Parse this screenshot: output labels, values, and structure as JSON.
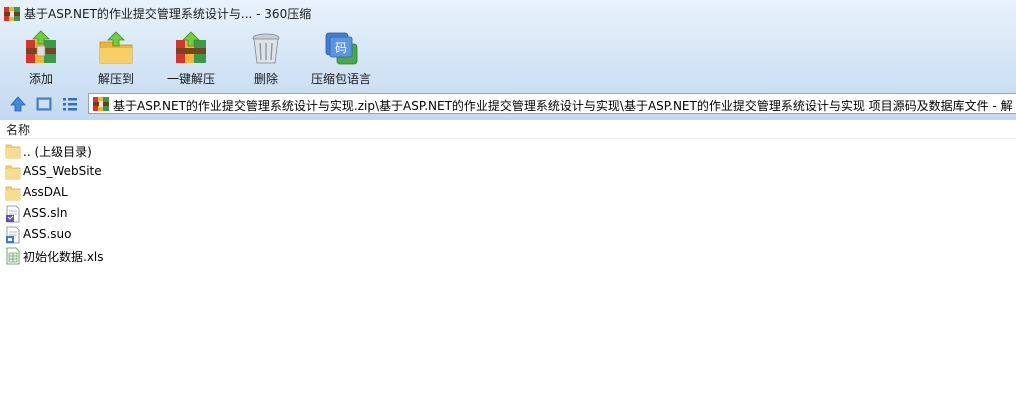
{
  "window": {
    "title": "基于ASP.NET的作业提交管理系统设计与... - 360压缩"
  },
  "toolbar": {
    "buttons": [
      {
        "label": "添加",
        "icon": "add-archive-icon"
      },
      {
        "label": "解压到",
        "icon": "extract-to-icon"
      },
      {
        "label": "一键解压",
        "icon": "one-click-extract-icon"
      },
      {
        "label": "删除",
        "icon": "delete-icon"
      },
      {
        "label": "压缩包语言",
        "icon": "archive-language-icon"
      }
    ]
  },
  "address_bar": {
    "path": "基于ASP.NET的作业提交管理系统设计与实现.zip\\基于ASP.NET的作业提交管理系统设计与实现\\基于ASP.NET的作业提交管理系统设计与实现 项目源码及数据库文件 - 解"
  },
  "file_list": {
    "column_name": "名称",
    "items": [
      {
        "name": ".. (上级目录)",
        "type": "folder"
      },
      {
        "name": "ASS_WebSite",
        "type": "folder"
      },
      {
        "name": "AssDAL",
        "type": "folder"
      },
      {
        "name": "ASS.sln",
        "type": "sln"
      },
      {
        "name": "ASS.suo",
        "type": "suo"
      },
      {
        "name": "初始化数据.xls",
        "type": "xls"
      }
    ]
  },
  "colors": {
    "chrome_top": "#e9f2fb",
    "chrome_bottom": "#c4d9ef",
    "folder": "#f5d27a"
  }
}
